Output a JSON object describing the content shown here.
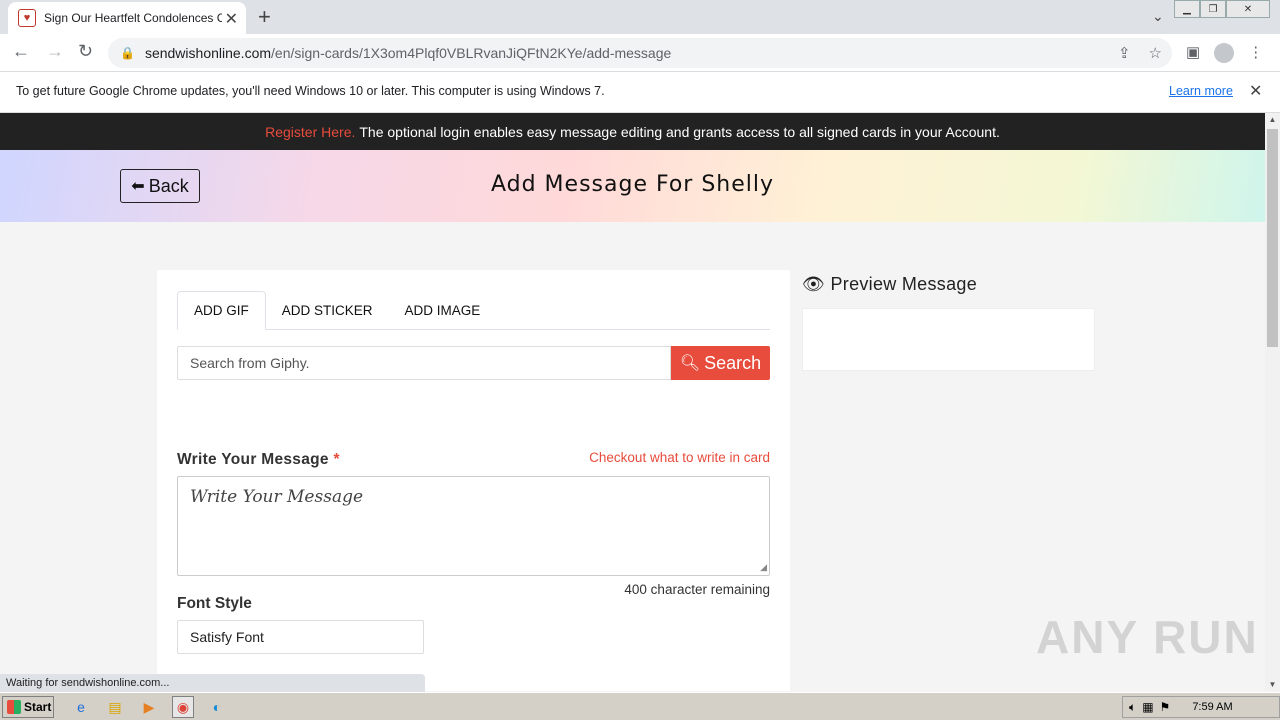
{
  "browser": {
    "tab_title": "Sign Our Heartfelt Condolences Card",
    "url_domain": "sendwishonline.com",
    "url_path": "/en/sign-cards/1X3om4Plqf0VBLRvanJiQFtN2KYe/add-message",
    "infobar_text": "To get future Google Chrome updates, you'll need Windows 10 or later. This computer is using Windows 7.",
    "infobar_link": "Learn more",
    "status_text": "Waiting for sendwishonline.com..."
  },
  "banner": {
    "register_link": "Register Here.",
    "register_text": "The optional login enables easy message editing and grants access to all signed cards in your Account."
  },
  "header": {
    "back_label": "Back",
    "title": "Add Message For Shelly"
  },
  "media_tabs": [
    {
      "label": "ADD GIF",
      "active": true
    },
    {
      "label": "ADD STICKER",
      "active": false
    },
    {
      "label": "ADD IMAGE",
      "active": false
    }
  ],
  "giphy": {
    "placeholder": "Search from Giphy.",
    "search_label": "Search"
  },
  "message": {
    "label": "Write Your Message",
    "required_mark": "*",
    "help_link": "Checkout what to write in card",
    "placeholder": "Write Your Message",
    "remaining": "400 character remaining"
  },
  "font_style": {
    "label": "Font Style",
    "selected": "Satisfy Font"
  },
  "preview": {
    "title": "Preview Message"
  },
  "watermark": "ANY RUN",
  "taskbar": {
    "start_label": "Start",
    "clock": "7:59 AM"
  },
  "colors": {
    "accent": "#e74c3c",
    "banner_bg": "#222222"
  }
}
